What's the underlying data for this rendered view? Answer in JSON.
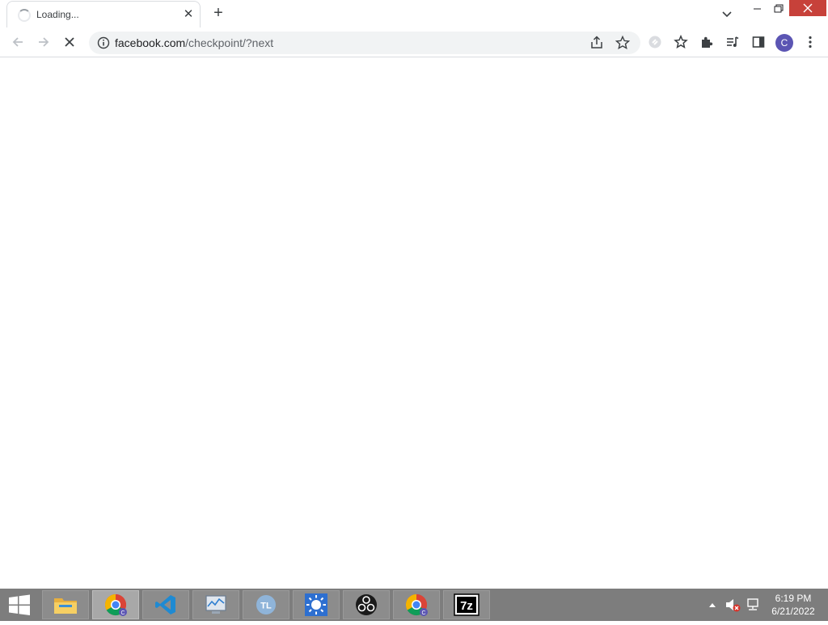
{
  "browser": {
    "tab": {
      "title": "Loading...",
      "close_glyph": "✕"
    },
    "new_tab_glyph": "+",
    "address": {
      "host": "facebook.com",
      "path": "/checkpoint/?next"
    },
    "profile_initial": "C"
  },
  "taskbar": {
    "apps": [
      "file-explorer",
      "chrome",
      "vscode",
      "task-manager",
      "tl-app",
      "weather-app",
      "obs",
      "chrome",
      "7zip"
    ],
    "clock": {
      "time": "6:19 PM",
      "date": "6/21/2022"
    }
  },
  "colors": {
    "close_red": "#c7413a",
    "taskbar": "#7d7d7d",
    "avatar": "#5b55b3",
    "vscode_blue": "#1f8ad2"
  }
}
